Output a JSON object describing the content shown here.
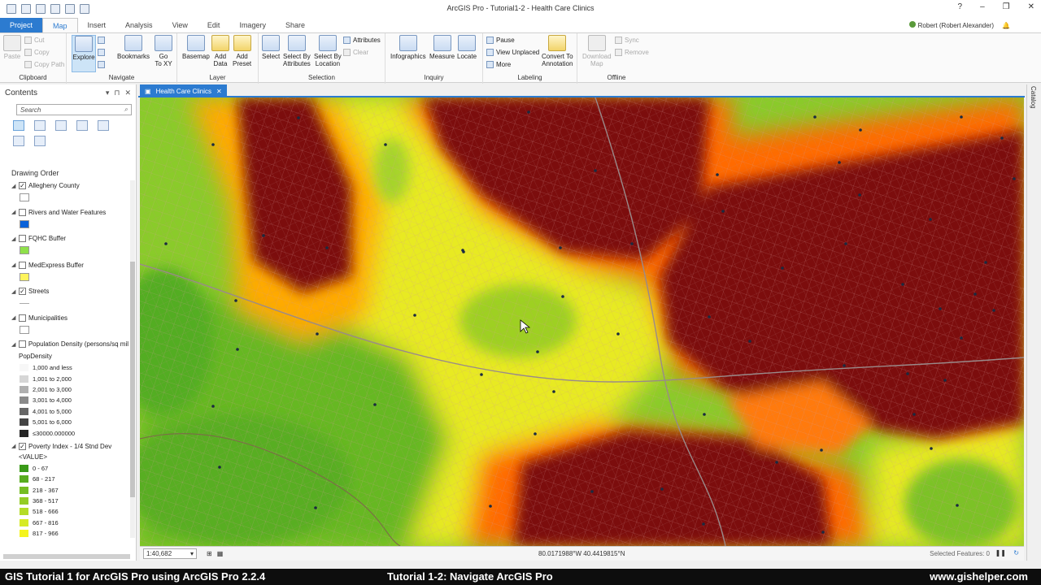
{
  "window": {
    "title": "ArcGIS Pro - Tutorial1-2 - Health Care Clinics",
    "controls": [
      "?",
      "–",
      "❐",
      "✕"
    ]
  },
  "ribbon": {
    "tabs": [
      "Project",
      "Map",
      "Insert",
      "Analysis",
      "View",
      "Edit",
      "Imagery",
      "Share"
    ],
    "active_tab": "Map",
    "user": "Robert (Robert Alexander)",
    "groups": {
      "clipboard": {
        "label": "Clipboard",
        "paste": "Paste",
        "cut": "Cut",
        "copy": "Copy",
        "copy_path": "Copy Path"
      },
      "navigate": {
        "label": "Navigate",
        "explore": "Explore",
        "bookmarks": "Bookmarks",
        "go_to_xy": "Go\nTo XY"
      },
      "layer": {
        "label": "Layer",
        "basemap": "Basemap",
        "add_data": "Add\nData",
        "add_preset": "Add\nPreset"
      },
      "selection": {
        "label": "Selection",
        "select": "Select",
        "select_by_attributes": "Select By\nAttributes",
        "select_by_location": "Select By\nLocation",
        "attributes": "Attributes",
        "clear": "Clear"
      },
      "inquiry": {
        "label": "Inquiry",
        "infographics": "Infographics",
        "measure": "Measure",
        "locate": "Locate"
      },
      "labeling": {
        "label": "Labeling",
        "pause": "Pause",
        "view_unplaced": "View Unplaced",
        "more": "More",
        "convert": "Convert To\nAnnotation"
      },
      "offline": {
        "label": "Offline",
        "download_map": "Download\nMap",
        "sync": "Sync",
        "remove": "Remove"
      }
    }
  },
  "contents": {
    "title": "Contents",
    "search_placeholder": "Search",
    "drawing_order": "Drawing Order",
    "layers": [
      {
        "name": "Allegheny County",
        "checked": true,
        "swatch": "#ffffff"
      },
      {
        "name": "Rivers and Water Features",
        "checked": false,
        "swatch": "#0a62d9"
      },
      {
        "name": "FQHC Buffer",
        "checked": false,
        "swatch": "#8fe04a"
      },
      {
        "name": "MedExpress Buffer",
        "checked": false,
        "swatch": "#fff45c"
      },
      {
        "name": "Streets",
        "checked": true,
        "swatch": "line"
      },
      {
        "name": "Municipalities",
        "checked": false,
        "swatch": "#ffffff"
      },
      {
        "name": "Population Density (persons/sq mil",
        "checked": false,
        "swatch": "none"
      }
    ],
    "pop_legend": {
      "title": "PopDensity",
      "items": [
        {
          "label": "1,000 and less",
          "color": "#f7f7f7"
        },
        {
          "label": "1,001 to 2,000",
          "color": "#d6d6d6"
        },
        {
          "label": "2,001 to 3,000",
          "color": "#b0b0b0"
        },
        {
          "label": "3,001 to 4,000",
          "color": "#8a8a8a"
        },
        {
          "label": "4,001 to 5,000",
          "color": "#666666"
        },
        {
          "label": "5,001 to 6,000",
          "color": "#444444"
        },
        {
          "label": "≤30000.000000",
          "color": "#252525"
        }
      ]
    },
    "poverty_layer": {
      "name": "Poverty Index - 1/4 Stnd Dev",
      "checked": true
    },
    "poverty_legend": {
      "title": "<VALUE>",
      "items": [
        {
          "label": "0 - 67",
          "color": "#3a9a18"
        },
        {
          "label": "68 - 217",
          "color": "#58ac1e"
        },
        {
          "label": "218 - 367",
          "color": "#75bd22"
        },
        {
          "label": "368 - 517",
          "color": "#94cc25"
        },
        {
          "label": "518 - 666",
          "color": "#b4dc26"
        },
        {
          "label": "667 - 816",
          "color": "#d6ea24"
        },
        {
          "label": "817 - 966",
          "color": "#f4f41e"
        }
      ]
    }
  },
  "map": {
    "tab_label": "Health Care Clinics",
    "colors": {
      "dark_red": "#7c0c08",
      "red": "#c01a08",
      "orange": "#ff6a00",
      "amber": "#ffaa00",
      "yellow": "#f2ee20",
      "yellow_green": "#c8e22a",
      "green": "#8acb2a",
      "deep_green": "#52ad22"
    }
  },
  "status": {
    "scale": "1:40,682",
    "coordinates": "80.0171988°W 40.4419815°N",
    "selected_features": "Selected Features: 0"
  },
  "catalog_label": "Catalog",
  "caption": {
    "left": "GIS Tutorial 1 for ArcGIS Pro using ArcGIS Pro 2.2.4",
    "center": "Tutorial 1-2: Navigate ArcGIS Pro",
    "right": "www.gishelper.com"
  }
}
